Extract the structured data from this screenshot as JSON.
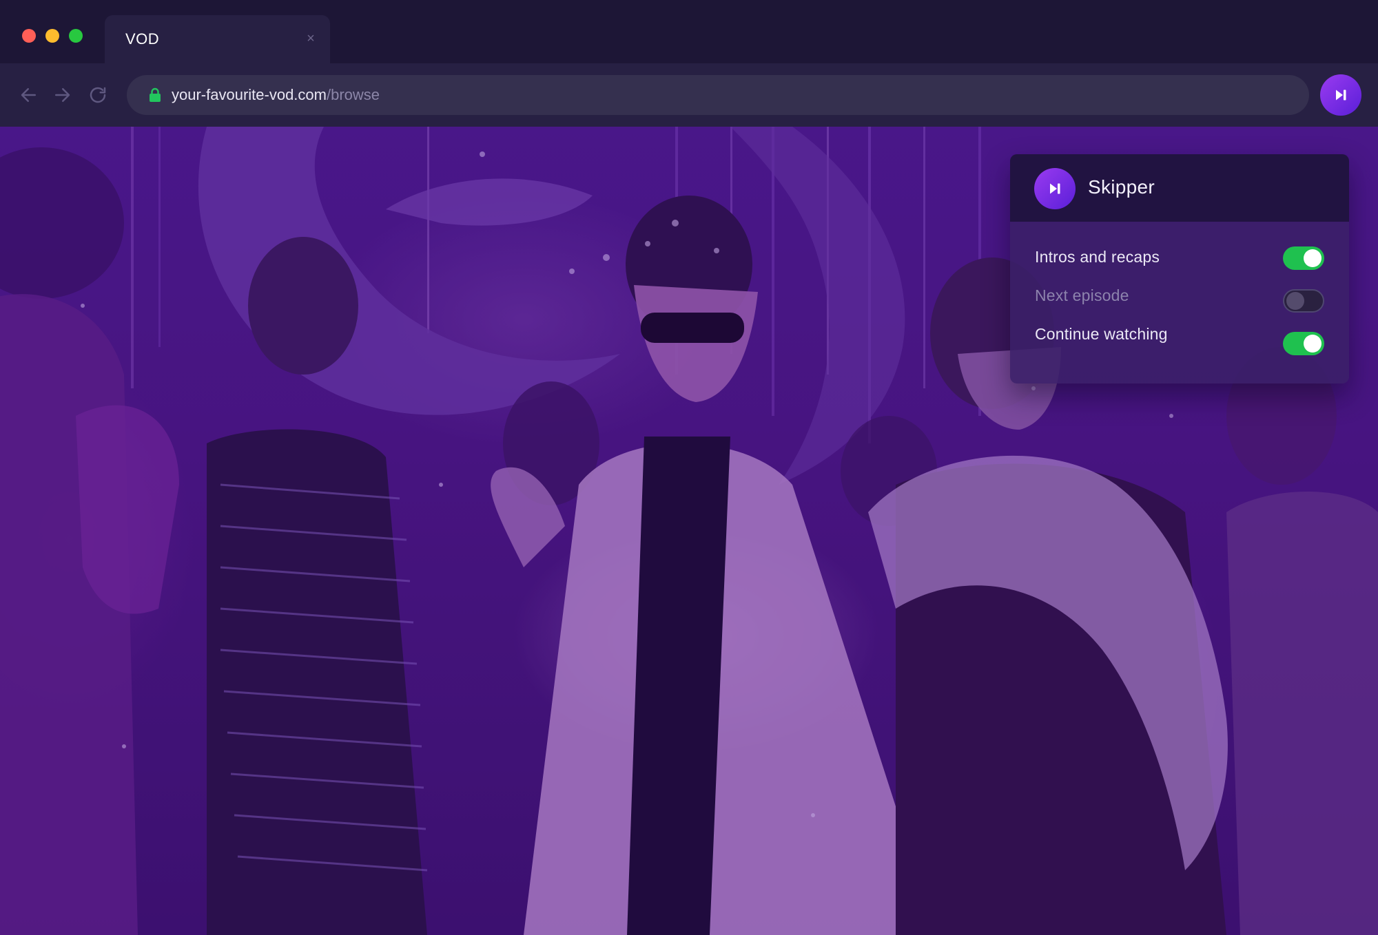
{
  "browser": {
    "traffic_lights": {
      "close_color": "#ff5f57",
      "minimize_color": "#febc2e",
      "maximize_color": "#28c840"
    },
    "tab": {
      "title": "VOD",
      "close_icon": "×"
    },
    "nav": {
      "back_icon": "arrow-left-icon",
      "forward_icon": "arrow-right-icon",
      "reload_icon": "reload-icon"
    },
    "address": {
      "lock_icon": "lock-icon",
      "lock_color": "#22c55e",
      "domain": "your-favourite-vod.com",
      "path": "/browse"
    },
    "extension_button": {
      "icon": "play-skip-icon",
      "color": "#7c2fe6"
    }
  },
  "popup": {
    "title": "Skipper",
    "logo_icon": "play-skip-icon",
    "settings": [
      {
        "label": "Intros and recaps",
        "enabled": true
      },
      {
        "label": "Next episode",
        "enabled": false
      },
      {
        "label": "Continue watching",
        "enabled": true
      }
    ],
    "toggle_on_color": "#1fc14f"
  },
  "colors": {
    "titlebar": "#1d1636",
    "toolbar": "#272043",
    "urlbar": "#35304f",
    "scene_tint": "#4c1a8e"
  }
}
